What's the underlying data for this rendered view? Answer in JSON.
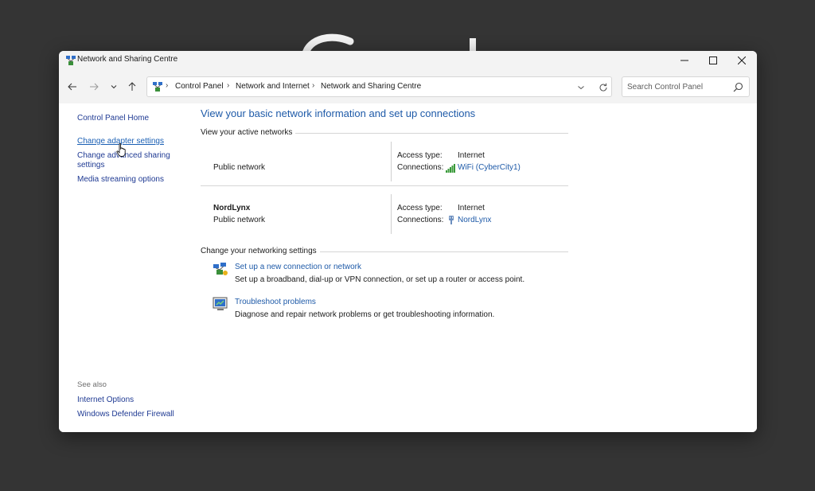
{
  "window": {
    "title": "Network and Sharing Centre"
  },
  "nav": {
    "back_icon": "back-arrow-icon",
    "forward_icon": "forward-arrow-icon",
    "recent_icon": "chevron-down-icon",
    "up_icon": "up-arrow-icon"
  },
  "address": {
    "crumbs": [
      "Control Panel",
      "Network and Internet",
      "Network and Sharing Centre"
    ]
  },
  "search": {
    "placeholder": "Search Control Panel"
  },
  "sidebar": {
    "links": [
      {
        "label": "Control Panel Home"
      },
      {
        "label": "Change adapter settings"
      },
      {
        "label_line1": "Change advanced sharing",
        "label_line2": "settings"
      },
      {
        "label": "Media streaming options"
      }
    ],
    "see_also": {
      "heading": "See also",
      "links": [
        "Internet Options",
        "Windows Defender Firewall"
      ]
    }
  },
  "main": {
    "heading": "View your basic network information and set up connections",
    "active_networks_label": "View your active networks",
    "networks": [
      {
        "name": "",
        "type": "Public network",
        "access_key": "Access type:",
        "access_value": "Internet",
        "connections_key": "Connections:",
        "connection": "WiFi (CyberCity1)",
        "connection_icon": "wifi-signal-icon"
      },
      {
        "name": "NordLynx",
        "type": "Public network",
        "access_key": "Access type:",
        "access_value": "Internet",
        "connections_key": "Connections:",
        "connection": "NordLynx",
        "connection_icon": "ethernet-plug-icon"
      }
    ],
    "change_settings_label": "Change your networking settings",
    "tasks": [
      {
        "link": "Set up a new connection or network",
        "desc": "Set up a broadband, dial-up or VPN connection, or set up a router or access point.",
        "icon": "new-connection-icon"
      },
      {
        "link": "Troubleshoot problems",
        "desc": "Diagnose and repair network problems or get troubleshooting information.",
        "icon": "troubleshoot-icon"
      }
    ]
  },
  "colors": {
    "link": "#1e5aa8",
    "heading": "#1e5aa8",
    "chrome": "#f3f3f3",
    "desktop": "#343434"
  }
}
